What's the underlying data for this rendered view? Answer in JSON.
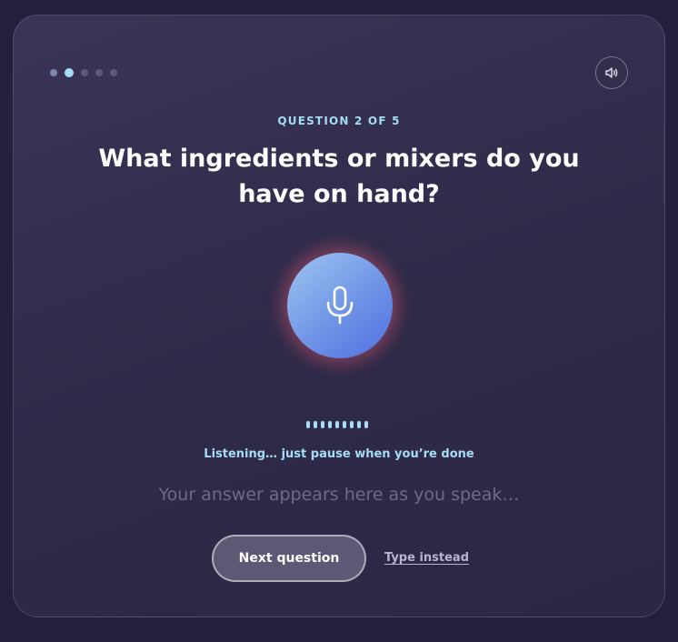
{
  "progress": {
    "total_steps": 5,
    "current_step": 2
  },
  "header": {
    "sound_icon": "speaker-icon"
  },
  "question": {
    "counter": "QUESTION 2 OF 5",
    "text": "What ingredients or mixers do you have on hand?"
  },
  "mic": {
    "icon": "microphone-icon",
    "state": "listening"
  },
  "status": {
    "text": "Listening… just pause when you’re done"
  },
  "transcript": {
    "placeholder": "Your answer appears here as you speak…"
  },
  "actions": {
    "next_label": "Next question",
    "type_label": "Type instead"
  },
  "colors": {
    "background": "#251f3d",
    "card": "#332d4e",
    "accent": "#a5dcf5",
    "mic_gradient_start": "#9ec6f1",
    "mic_gradient_end": "#506fe0",
    "glow": "#eb5f78"
  }
}
